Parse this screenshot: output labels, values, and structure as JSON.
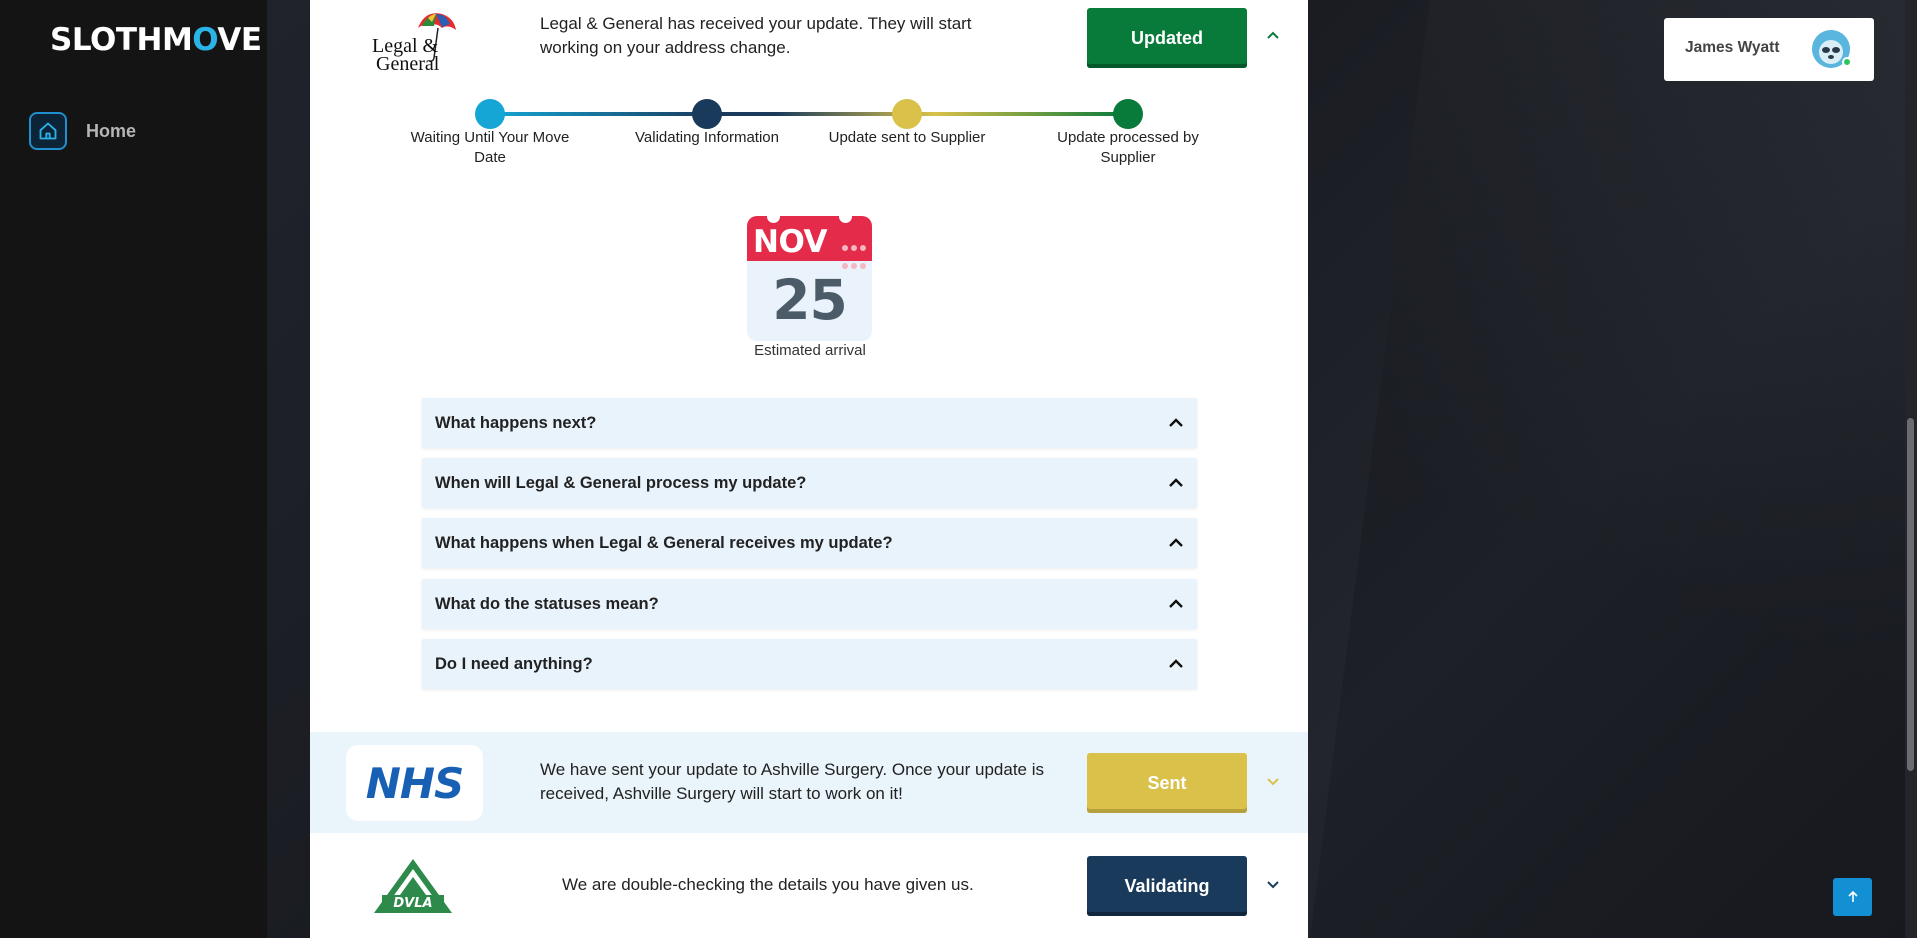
{
  "app": {
    "logo_part1": "SL",
    "logo_o": "O",
    "logo_part2": "TH",
    "logo_move_m": "M",
    "logo_move_rest": "VE"
  },
  "sidebar": {
    "items": [
      {
        "label": "Home",
        "icon": "home-icon"
      }
    ]
  },
  "user": {
    "name": "James Wyatt",
    "status": "online"
  },
  "suppliers": [
    {
      "logo_text": "Legal & General",
      "message": "Legal & General has received your update. They will start working on your address change.",
      "status": "Updated",
      "status_color": "#087a3a",
      "expanded": true
    },
    {
      "logo_text": "NHS",
      "message": "We have sent your update to Ashville Surgery. Once your update is received, Ashville Surgery will start to work on it!",
      "status": "Sent",
      "status_color": "#d9c14a",
      "expanded": false
    },
    {
      "logo_text": "DVLA",
      "message": "We are double-checking the details you have given us.",
      "status": "Validating",
      "status_color": "#1a3a5c",
      "expanded": false
    }
  ],
  "stepper": {
    "steps": [
      {
        "label": "Waiting Until Your Move Date",
        "color": "#15a6d6"
      },
      {
        "label": "Validating Information",
        "color": "#1a3a5c"
      },
      {
        "label": "Update sent to Supplier",
        "color": "#d9c14a"
      },
      {
        "label": "Update processed by Supplier",
        "color": "#087a3a"
      }
    ]
  },
  "arrival": {
    "month": "NOV",
    "day": "25",
    "caption": "Estimated arrival"
  },
  "faq": [
    "What happens next?",
    "When will Legal & General process my update?",
    "What happens when Legal & General receives my update?",
    "What do the statuses mean?",
    "Do I need anything?"
  ]
}
